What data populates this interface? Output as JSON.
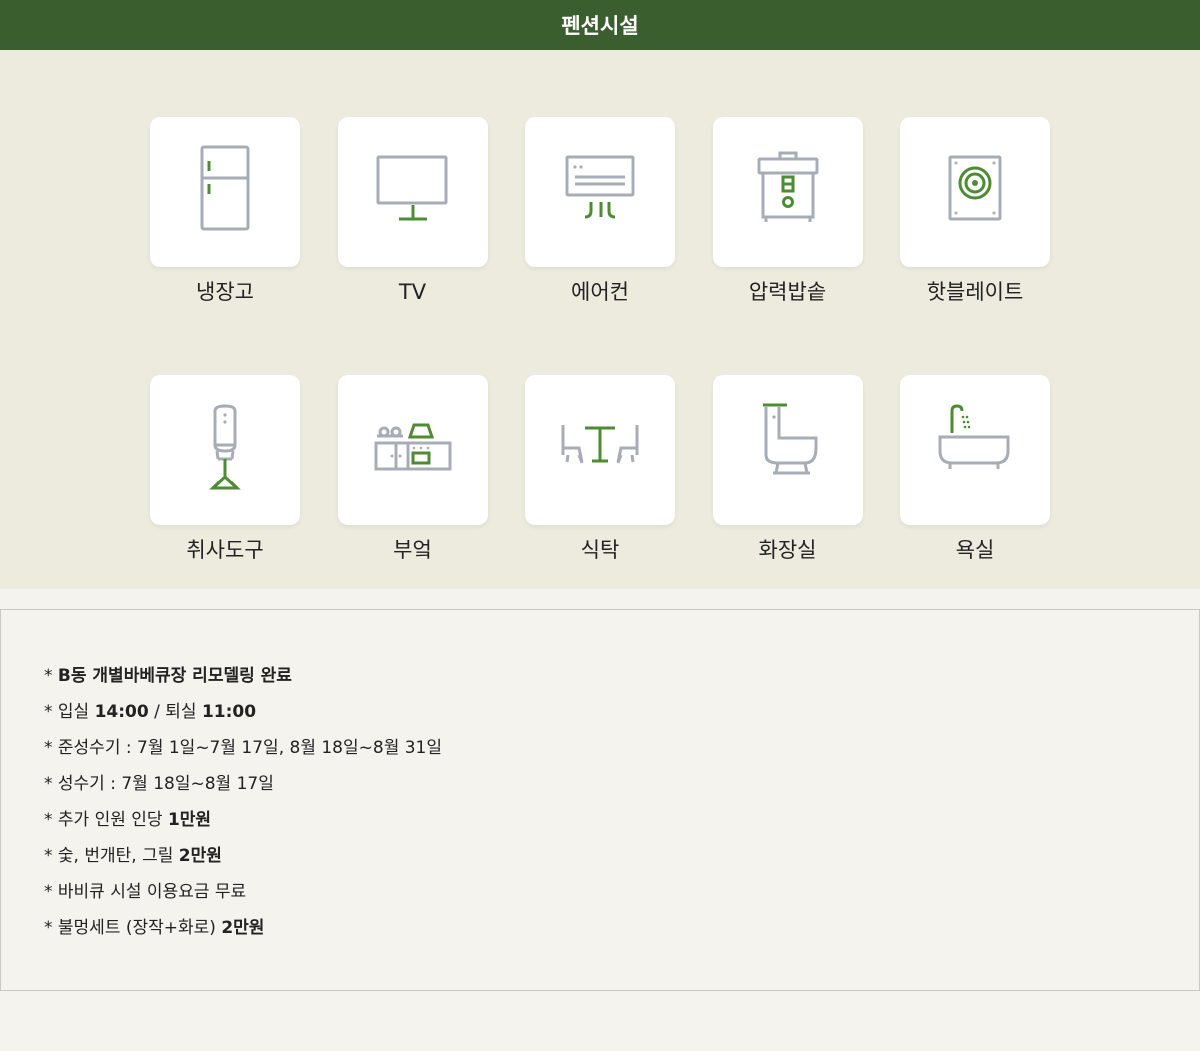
{
  "page_title": "펜션시설",
  "facilities": [
    {
      "label": "냉장고",
      "icon": "refrigerator-icon"
    },
    {
      "label": "TV",
      "icon": "tv-icon"
    },
    {
      "label": "에어컨",
      "icon": "air-conditioner-icon"
    },
    {
      "label": "압력밥솥",
      "icon": "rice-cooker-icon"
    },
    {
      "label": "핫블레이트",
      "icon": "hot-plate-icon"
    },
    {
      "label": "취사도구",
      "icon": "cooking-utensil-icon"
    },
    {
      "label": "부엌",
      "icon": "kitchen-icon"
    },
    {
      "label": "식탁",
      "icon": "dining-table-icon"
    },
    {
      "label": "화장실",
      "icon": "toilet-icon"
    },
    {
      "label": "욕실",
      "icon": "bathtub-icon"
    }
  ],
  "notices": [
    {
      "parts": [
        {
          "text": "* ",
          "bold": false
        },
        {
          "text": "B동 개별바베큐장 리모델링 완료",
          "bold": true
        }
      ]
    },
    {
      "parts": [
        {
          "text": "* 입실 ",
          "bold": false
        },
        {
          "text": "14:00",
          "bold": true
        },
        {
          "text": " / 퇴실 ",
          "bold": false
        },
        {
          "text": "11:00",
          "bold": true
        }
      ]
    },
    {
      "parts": [
        {
          "text": "* 준성수기 : 7월 1일~7월 17일, 8월 18일~8월 31일",
          "bold": false
        }
      ]
    },
    {
      "parts": [
        {
          "text": "* 성수기 : 7월 18일~8월 17일",
          "bold": false
        }
      ]
    },
    {
      "parts": [
        {
          "text": "* 추가 인원 인당 ",
          "bold": false
        },
        {
          "text": "1만원",
          "bold": true
        }
      ]
    },
    {
      "parts": [
        {
          "text": "* 숯, 번개탄, 그릴 ",
          "bold": false
        },
        {
          "text": "2만원",
          "bold": true
        }
      ]
    },
    {
      "parts": [
        {
          "text": "* 바비큐 시설 이용요금 무료",
          "bold": false
        }
      ]
    },
    {
      "parts": [
        {
          "text": "* 불멍세트 (장작+화로) ",
          "bold": false
        },
        {
          "text": "2만원",
          "bold": true
        }
      ]
    }
  ],
  "colors": {
    "header_bg": "#3b5e2f",
    "accent_green": "#4e8c33",
    "icon_gray": "#a7acb6",
    "section_bg": "#ecebde"
  }
}
